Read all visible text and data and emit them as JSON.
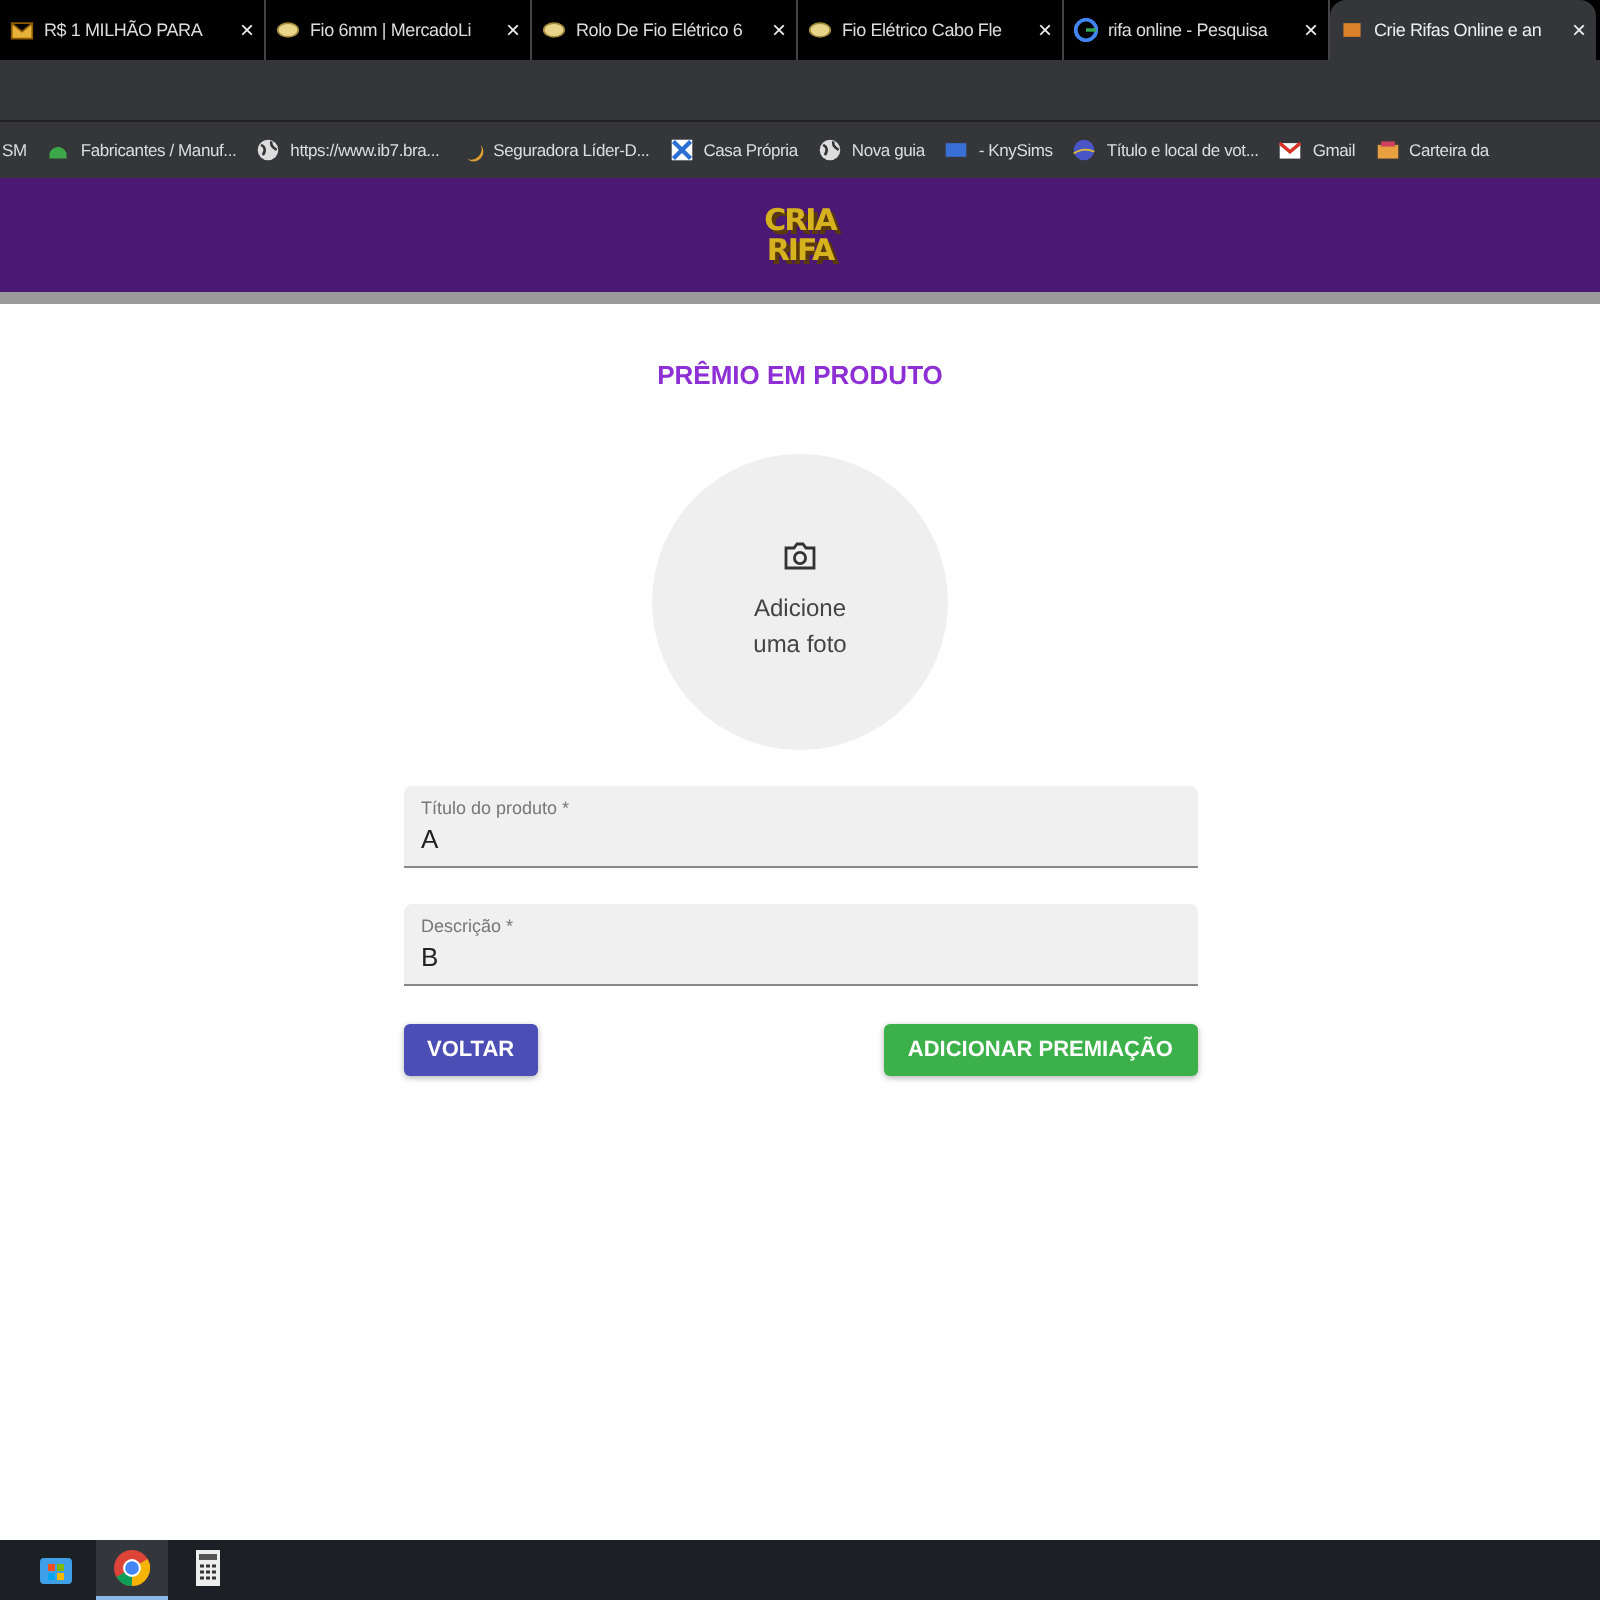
{
  "tabs": [
    {
      "title": "R$ 1 MILHÃO PARA",
      "close": "×",
      "selected": false
    },
    {
      "title": "Fio 6mm | MercadoLi",
      "close": "×",
      "selected": false
    },
    {
      "title": "Rolo De Fio Elétrico 6",
      "close": "×",
      "selected": false
    },
    {
      "title": "Fio Elétrico Cabo Fle",
      "close": "×",
      "selected": false
    },
    {
      "title": "rifa online - Pesquisa",
      "close": "×",
      "selected": false
    },
    {
      "title": "Crie Rifas Online e an",
      "close": "×",
      "selected": true
    }
  ],
  "bookmarks": [
    {
      "label": "SM"
    },
    {
      "label": "Fabricantes / Manuf..."
    },
    {
      "label": "https://www.ib7.bra..."
    },
    {
      "label": "Seguradora Líder-D..."
    },
    {
      "label": "Casa Própria"
    },
    {
      "label": "Nova guia"
    },
    {
      "label": "- KnySims"
    },
    {
      "label": "Título e local de vot..."
    },
    {
      "label": "Gmail"
    },
    {
      "label": "Carteira da"
    }
  ],
  "logo": [
    "CRIA",
    "RIFA"
  ],
  "form": {
    "title": "PRÊMIO EM PRODUTO",
    "photo": [
      "Adicione",
      "uma foto"
    ],
    "fields": [
      {
        "label": "Título do produto *",
        "value": "A"
      },
      {
        "label": "Descrição *",
        "value": "B"
      }
    ],
    "buttons": [
      {
        "label": "VOLTAR",
        "kind": "secondary"
      },
      {
        "label": "ADICIONAR PREMIAÇÃO",
        "kind": "primary"
      }
    ]
  },
  "taskbar": [
    {
      "selected": false
    },
    {
      "selected": true
    },
    {
      "selected": false
    }
  ]
}
